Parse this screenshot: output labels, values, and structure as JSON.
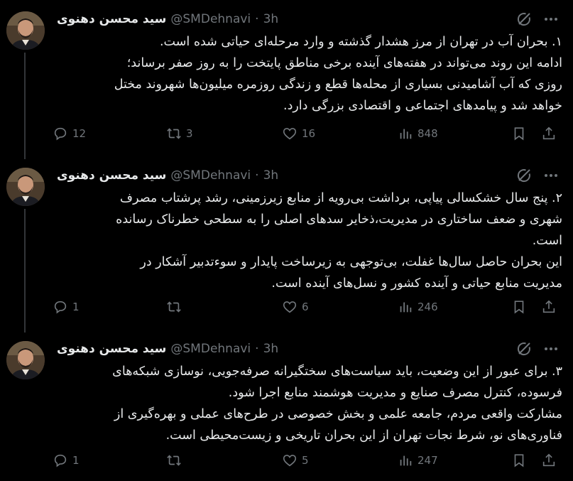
{
  "author": {
    "name": "سید محسن دهنوی",
    "handle": "@SMDehnavi",
    "separator": "·"
  },
  "tweets": [
    {
      "time": "3h",
      "lines": [
        "۱. بحران آب در تهران از مرز هشدار گذشته و وارد مرحله‌ای حیاتی شده است.",
        "ادامه این روند می‌تواند در هفته‌های آینده برخی مناطق پایتخت را به روز صفر برساند؛",
        "روزی که آب آشامیدنی بسیاری از محله‌ها قطع و زندگی روزمره میلیون‌ها شهروند مختل",
        "خواهد شد و پیامدهای اجتماعی و اقتصادی بزرگی دارد."
      ],
      "stats": {
        "replies": "12",
        "reposts": "3",
        "likes": "16",
        "views": "848"
      }
    },
    {
      "time": "3h",
      "lines": [
        "۲. پنج سال خشکسالی پیاپی، برداشت بی‌رویه از منابع زیرزمینی، رشد پرشتاب مصرف",
        "شهری و ضعف ساختاری در مدیریت،ذخایر سدهای اصلی را به سطحی خطرناک رسانده",
        "است.",
        "این بحران حاصل سال‌ها غفلت، بی‌توجهی به زیرساخت پایدار و سوءتدبیر آشکار در",
        "مدیریت منابع حیاتی و آینده کشور و نسل‌های آینده است."
      ],
      "stats": {
        "replies": "1",
        "reposts": "",
        "likes": "6",
        "views": "246"
      }
    },
    {
      "time": "3h",
      "lines": [
        "۳. برای عبور از این وضعیت، باید سیاست‌های سختگیرانه صرفه‌جویی، نوسازی شبکه‌های",
        "فرسوده، کنترل مصرف صنایع و مدیریت هوشمند منابع اجرا شود.",
        "مشارکت واقعی مردم، جامعه علمی و بخش خصوصی در طرح‌های عملی و بهره‌گیری از",
        "فناوری‌های نو، شرط نجات تهران از این بحران تاریخی و زیست‌محیطی است."
      ],
      "stats": {
        "replies": "1",
        "reposts": "",
        "likes": "5",
        "views": "247"
      }
    }
  ],
  "icons": {
    "reply": "reply-icon",
    "repost": "repost-icon",
    "like": "heart-icon",
    "views": "views-icon",
    "bookmark": "bookmark-icon",
    "share": "share-icon",
    "grok": "grok-icon",
    "more": "more-icon"
  },
  "colors": {
    "background": "#000000",
    "text": "#e7e9ea",
    "muted": "#71767b",
    "thread_line": "#333639"
  }
}
